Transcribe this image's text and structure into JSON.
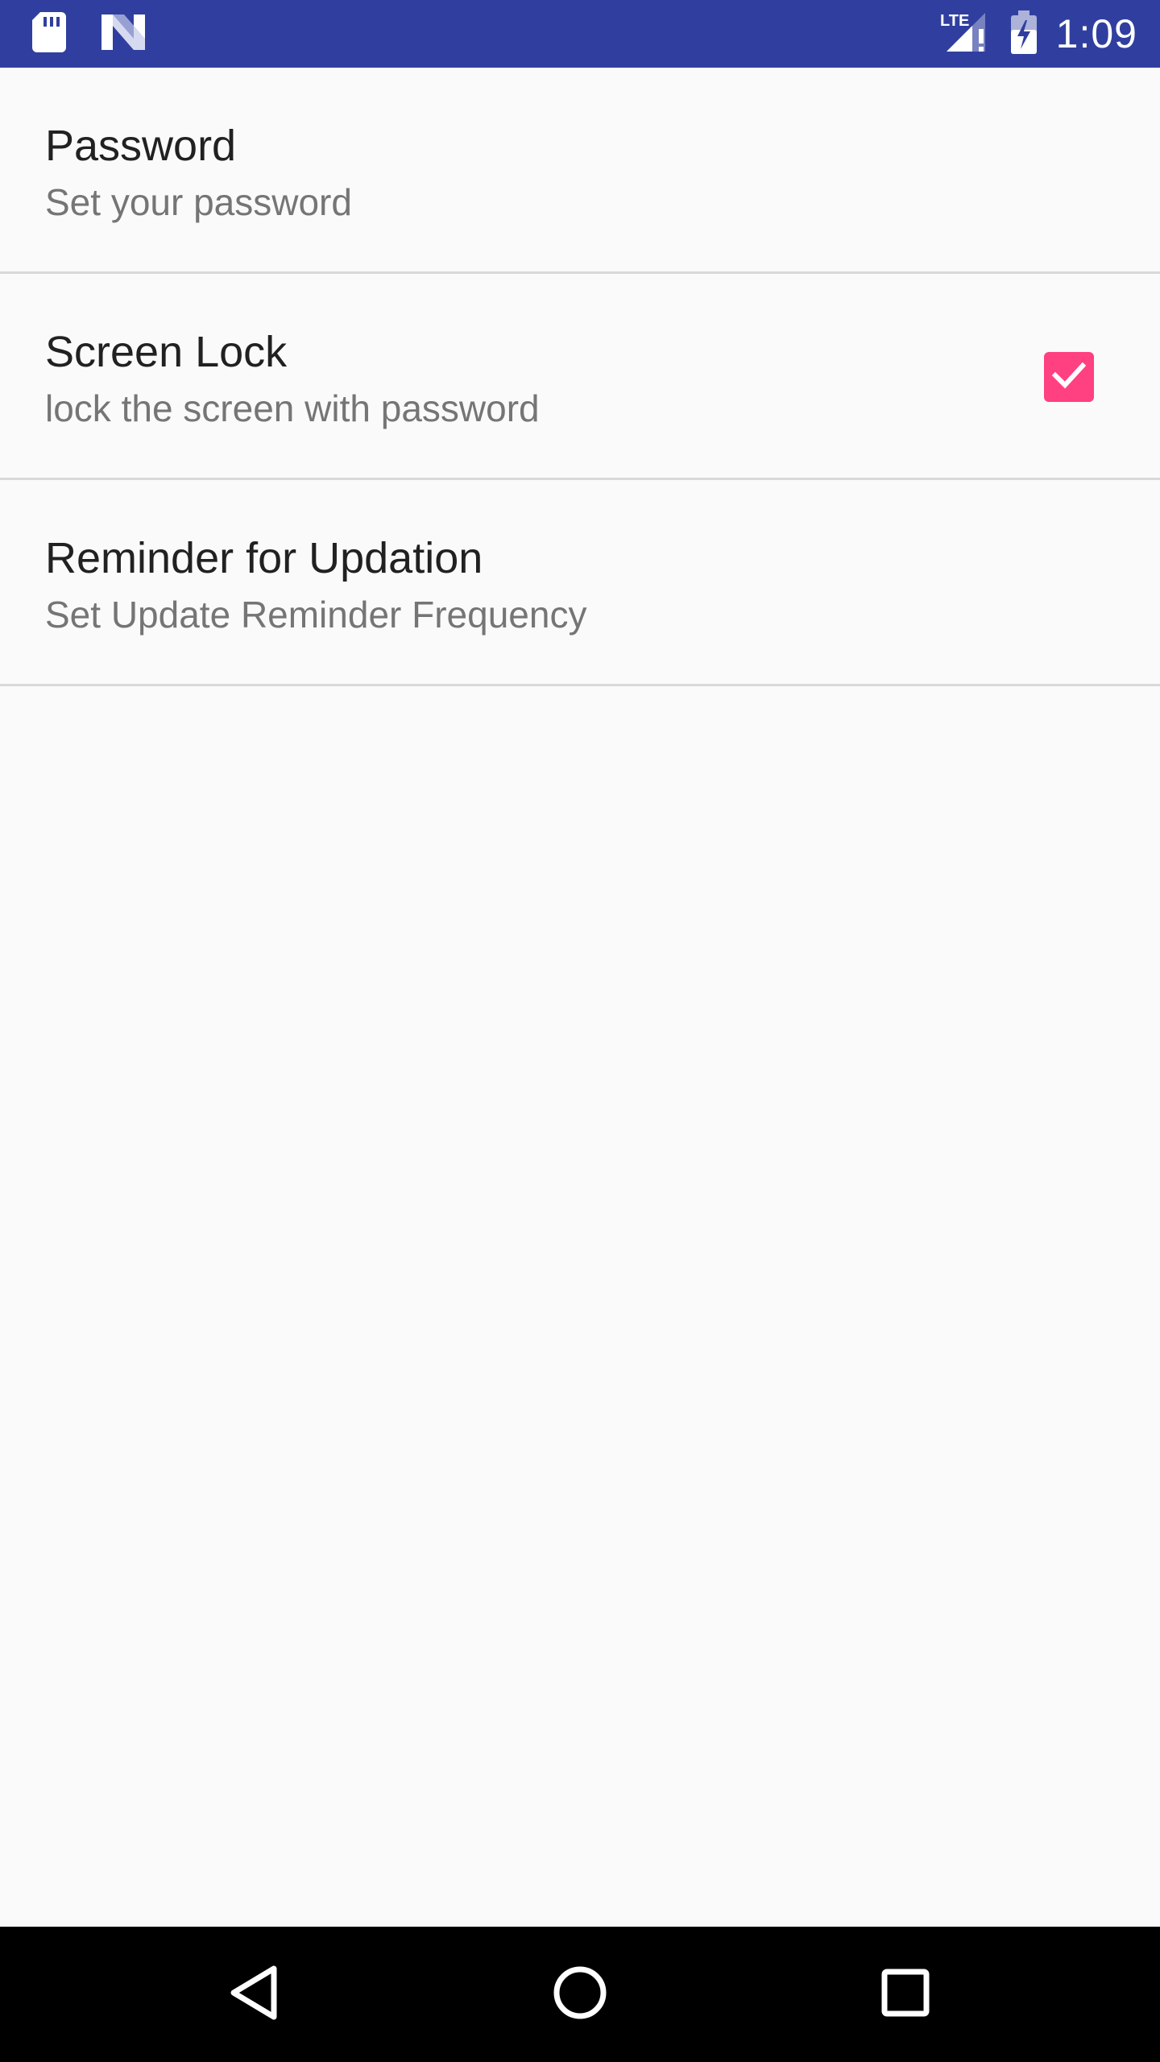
{
  "status_bar": {
    "time": "1:09",
    "network_label": "LTE",
    "background_color": "#303f9f",
    "icons": [
      "sd-card-icon",
      "n-logo-icon",
      "lte-signal-icon",
      "battery-charging-icon"
    ]
  },
  "preferences": [
    {
      "title": "Password",
      "summary": "Set your password"
    },
    {
      "title": "Screen Lock",
      "summary": "lock the screen with password",
      "checked": true,
      "accent_color": "#ff4081"
    },
    {
      "title": "Reminder for Updation",
      "summary": "Set Update Reminder Frequency"
    }
  ],
  "nav_bar": {
    "buttons": [
      "back-icon",
      "home-icon",
      "recents-icon"
    ]
  }
}
